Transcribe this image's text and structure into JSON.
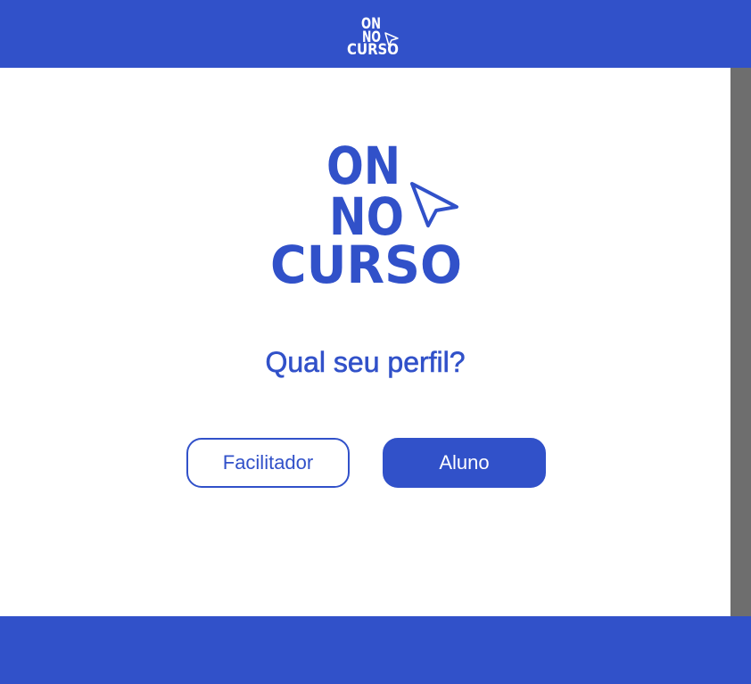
{
  "header": {
    "logo": {
      "line1": "ON",
      "line2": "NO",
      "line3": "CURSO"
    }
  },
  "main": {
    "logo": {
      "line1": "ON",
      "line2": "NO",
      "line3": "CURSO"
    },
    "question": "Qual seu perfil?",
    "buttons": {
      "facilitator": "Facilitador",
      "student": "Aluno"
    }
  },
  "colors": {
    "brand": "#3151C9",
    "scrollbar": "#6E6E6E",
    "background": "#FFFFFF"
  }
}
